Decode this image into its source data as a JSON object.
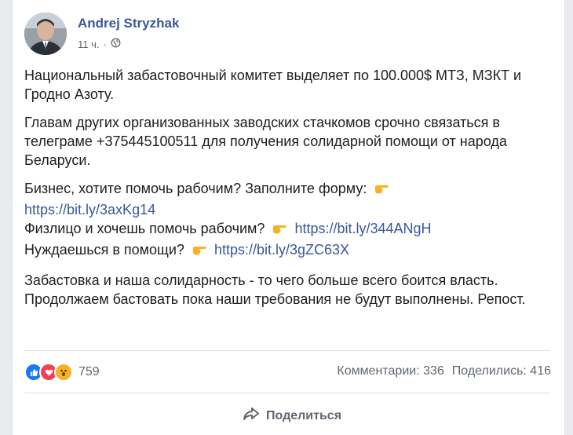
{
  "post": {
    "author": "Andrej Stryzhak",
    "time": "11 ч.",
    "dot": "·",
    "p1": "Национальный забастовочный комитет выделяет по 100.000$ МТЗ, МЗКТ и Гродно Азоту.",
    "p2": "Главам других организованных заводских стачкомов срочно связаться в телеграме +375445100511 для получения солидарной помощи от народа Беларуси.",
    "business_text": "Бизнес, хотите помочь рабочим? Заполните форму:",
    "business_link": "https://bit.ly/3axKg14",
    "person_text": "Физлицо и хочешь помочь рабочим?",
    "person_link": "https://bit.ly/344ANgH",
    "need_text": "Нуждаешься в помощи?",
    "need_link": "https://bit.ly/3gZC63X",
    "p4": "Забастовка и наша солидарность - то чего больше всего боится власть. Продолжаем бастовать пока наши требования не будут выполнены. Репост."
  },
  "footer": {
    "reactions_count": "759",
    "comments": "Комментарии: 336",
    "shares": "Поделились: 416",
    "share_button": "Поделиться"
  },
  "colors": {
    "link": "#385898",
    "like": "#1877f2",
    "love": "#f33e58",
    "wow": "#f7b125"
  },
  "icons": [
    "globe-icon",
    "pointing-right-emoji",
    "like-reaction-icon",
    "love-reaction-icon",
    "wow-reaction-icon",
    "share-arrow-icon"
  ]
}
